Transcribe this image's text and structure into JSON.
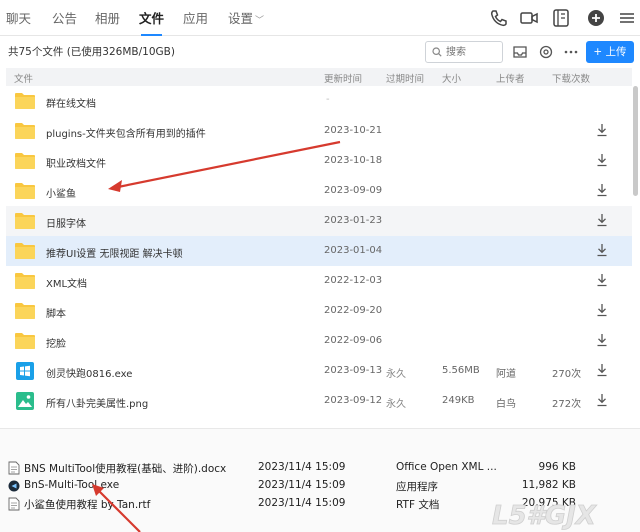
{
  "nav": {
    "tabs": [
      "聊天",
      "公告",
      "相册",
      "文件",
      "应用",
      "设置"
    ],
    "active_tab": "文件"
  },
  "toolbar": {
    "summary": "共75个文件 (已使用326MB/10GB)",
    "search_placeholder": "搜索",
    "upload_label": "+ 上传"
  },
  "table": {
    "headers": {
      "name": "文件",
      "updated": "更新时间",
      "expire": "过期时间",
      "size": "大小",
      "uploader": "上传者",
      "downloads": "下载次数"
    },
    "rows": [
      {
        "name": "群在线文档",
        "date": "-",
        "expire": "",
        "size": "",
        "uploader": "",
        "downloads": "",
        "icon": "folder-icon",
        "download": false
      },
      {
        "name": "plugins-文件夹包含所有用到的插件",
        "date": "2023-10-21",
        "expire": "",
        "size": "",
        "uploader": "",
        "downloads": "",
        "icon": "folder-icon",
        "download": true
      },
      {
        "name": "职业改档文件",
        "date": "2023-10-18",
        "expire": "",
        "size": "",
        "uploader": "",
        "downloads": "",
        "icon": "folder-icon",
        "download": true
      },
      {
        "name": "小鲨鱼",
        "date": "2023-09-09",
        "expire": "",
        "size": "",
        "uploader": "",
        "downloads": "",
        "icon": "folder-icon",
        "download": true
      },
      {
        "name": "日服字体",
        "date": "2023-01-23",
        "expire": "",
        "size": "",
        "uploader": "",
        "downloads": "",
        "icon": "folder-icon",
        "download": true
      },
      {
        "name": "推荐UI设置 无限视距 解决卡顿",
        "date": "2023-01-04",
        "expire": "",
        "size": "",
        "uploader": "",
        "downloads": "",
        "icon": "folder-icon",
        "download": true
      },
      {
        "name": "XML文档",
        "date": "2022-12-03",
        "expire": "",
        "size": "",
        "uploader": "",
        "downloads": "",
        "icon": "folder-icon",
        "download": true
      },
      {
        "name": "脚本",
        "date": "2022-09-20",
        "expire": "",
        "size": "",
        "uploader": "",
        "downloads": "",
        "icon": "folder-icon",
        "download": true
      },
      {
        "name": "挖脸",
        "date": "2022-09-06",
        "expire": "",
        "size": "",
        "uploader": "",
        "downloads": "",
        "icon": "folder-icon",
        "download": true
      },
      {
        "name": "创灵快跑0816.exe",
        "date": "2023-09-13",
        "expire": "永久",
        "size": "5.56MB",
        "uploader": "阿道",
        "downloads": "270次",
        "icon": "exe-icon",
        "download": true
      },
      {
        "name": "所有八卦完美属性.png",
        "date": "2023-09-12",
        "expire": "永久",
        "size": "249KB",
        "uploader": "白鸟",
        "downloads": "272次",
        "icon": "image-icon",
        "download": true
      }
    ]
  },
  "explorer": {
    "rows": [
      {
        "name": "BNS MultiTool使用教程(基础、进阶).docx",
        "date": "2023/11/4 15:09",
        "type": "Office Open XML ...",
        "size": "996 KB",
        "icon": "doc-file-icon"
      },
      {
        "name": "BnS-Multi-Tool.exe",
        "date": "2023/11/4 15:09",
        "type": "应用程序",
        "size": "11,982 KB",
        "icon": "app-file-icon"
      },
      {
        "name": "小鲨鱼使用教程 by Tan.rtf",
        "date": "2023/11/4 15:09",
        "type": "RTF 文档",
        "size": "20,975 KB",
        "icon": "rtf-file-icon"
      }
    ]
  },
  "colors": {
    "accent": "#1e88ff",
    "folder": "#f9c740",
    "annotation_arrow": "#d63a2e",
    "selected_row": "#e3eefb"
  }
}
